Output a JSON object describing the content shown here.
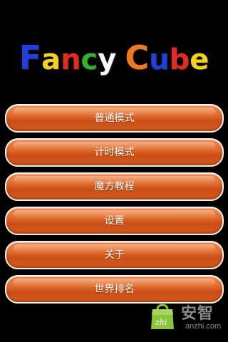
{
  "logo": {
    "letters": [
      {
        "char": "F",
        "color": "#1f3fe0",
        "big": true
      },
      {
        "char": "a",
        "color": "#f2d21a",
        "big": false
      },
      {
        "char": "n",
        "color": "#e52a1e",
        "big": false
      },
      {
        "char": "c",
        "color": "#2fb52a",
        "big": false
      },
      {
        "char": "y",
        "color": "#f7f7f7",
        "big": false
      },
      {
        "char": "C",
        "color": "#ef7a1c",
        "big": true
      },
      {
        "char": "u",
        "color": "#1f3fe0",
        "big": false
      },
      {
        "char": "b",
        "color": "#e52a1e",
        "big": false
      },
      {
        "char": "e",
        "color": "#f2d21a",
        "big": false
      }
    ]
  },
  "menu": {
    "items": [
      {
        "label": "普通模式"
      },
      {
        "label": "计时模式"
      },
      {
        "label": "魔方教程"
      },
      {
        "label": "设置"
      },
      {
        "label": "关于"
      },
      {
        "label": "世界排名"
      }
    ]
  },
  "watermark": {
    "title": "安智",
    "url": "anzhi.com",
    "bag_text": "zhi",
    "colors": {
      "bag": "#8cc43a",
      "text": "#8a8a8a"
    }
  }
}
